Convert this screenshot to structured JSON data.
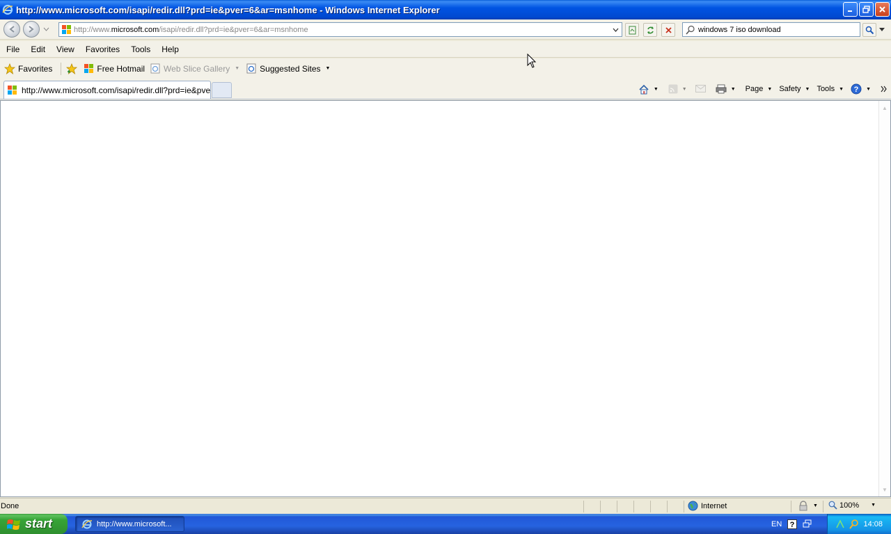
{
  "window": {
    "title": "http://www.microsoft.com/isapi/redir.dll?prd=ie&pver=6&ar=msnhome - Windows Internet Explorer",
    "icons": {
      "app": "ie-icon",
      "minimize": "minimize-icon",
      "maximize": "restore-icon",
      "close": "close-icon"
    }
  },
  "nav": {
    "address_prefix": "http://www.",
    "address_domain": "microsoft.com",
    "address_rest": "/isapi/redir.dll?prd=ie&pver=6&ar=msnhome",
    "search_value": "windows 7 iso download"
  },
  "menu": {
    "items": [
      "File",
      "Edit",
      "View",
      "Favorites",
      "Tools",
      "Help"
    ]
  },
  "favorites_bar": {
    "favorites_label": "Favorites",
    "items": [
      {
        "label": "Free Hotmail",
        "icon": "windows-logo-icon",
        "disabled": false
      },
      {
        "label": "Web Slice Gallery",
        "icon": "ie-page-icon",
        "disabled": true
      },
      {
        "label": "Suggested Sites",
        "icon": "ie-page-icon",
        "disabled": false
      }
    ]
  },
  "tabs": {
    "active_label": "http://www.microsoft.com/isapi/redir.dll?prd=ie&pver..."
  },
  "command_bar": {
    "page": "Page",
    "safety": "Safety",
    "tools": "Tools"
  },
  "status": {
    "text": "Done",
    "zone": "Internet",
    "zoom": "100%"
  },
  "taskbar": {
    "start": "start",
    "task": "http://www.microsoft...",
    "lang": "EN",
    "clock": "14:08"
  },
  "colors": {
    "titlebar": "#0054e3",
    "taskbar": "#245edb",
    "start": "#37a437"
  }
}
